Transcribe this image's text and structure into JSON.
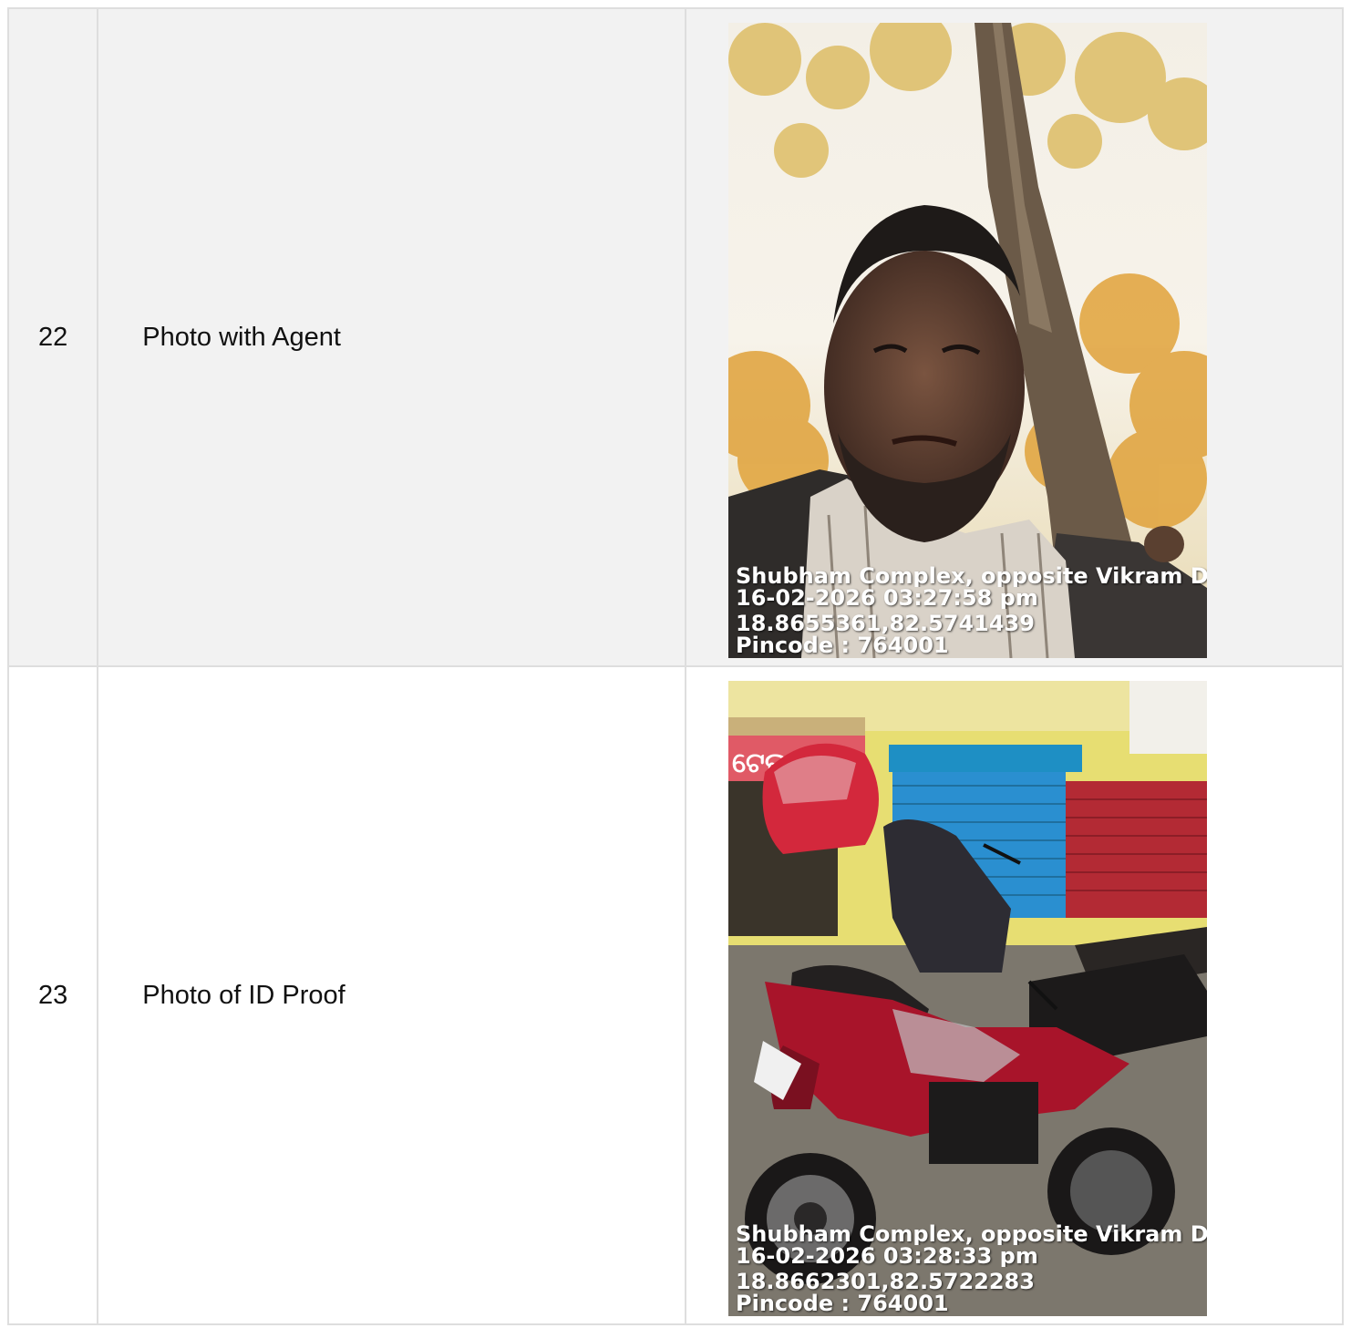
{
  "rows": [
    {
      "number": "22",
      "label": "Photo with Agent",
      "photo": {
        "subject": "selfie of a bearded man under a tree",
        "stamp": {
          "address": "Shubham Complex, opposite Vikram Dev Col",
          "datetime": "16-02-2026 03:27:58 pm",
          "coordinates": "18.8655361,82.5741439",
          "pincode": "Pincode : 764001"
        }
      }
    },
    {
      "number": "23",
      "label": "Photo of ID Proof",
      "photo": {
        "subject": "red motorcycle with helmet and backpack parked in front of shops",
        "signage": [
          "ଟେଲ ଶୁଭମ୍"
        ],
        "stamp": {
          "address": "Shubham Complex, opposite Vikram Dev Col",
          "datetime": "16-02-2026 03:28:33 pm",
          "coordinates": "18.8662301,82.5722283",
          "pincode": "Pincode : 764001"
        }
      }
    }
  ],
  "colors": {
    "border": "#dedede",
    "shaded_row": "#f2f2f2",
    "text": "#111111",
    "stamp_text": "#ffffff"
  }
}
